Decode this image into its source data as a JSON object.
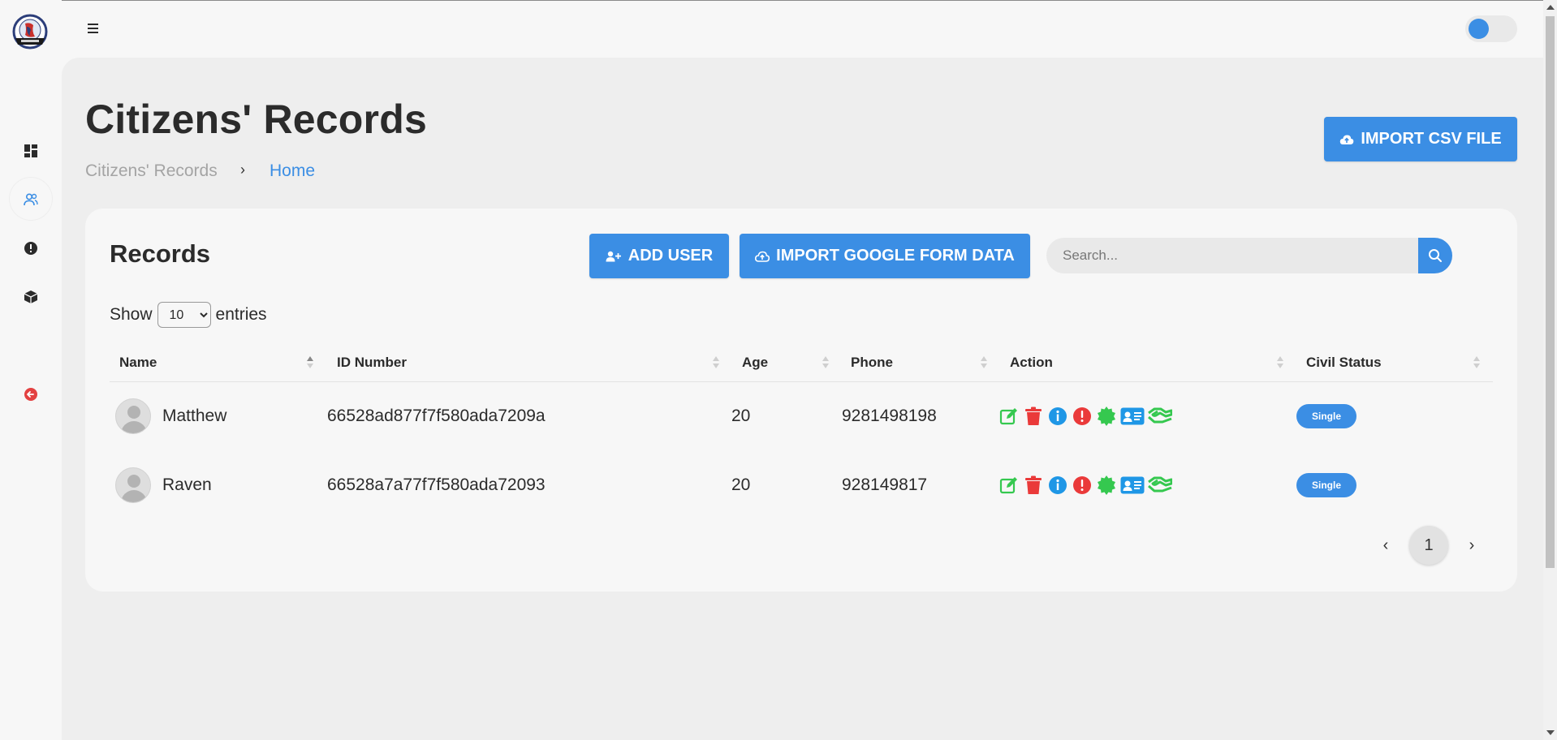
{
  "header": {
    "page_title": "Citizens' Records",
    "breadcrumb": [
      "Citizens' Records",
      "Home"
    ],
    "import_csv_label": "IMPORT CSV FILE",
    "theme_toggle_on": true
  },
  "sidebar": {
    "items": [
      {
        "name": "dashboard-icon"
      },
      {
        "name": "users-icon",
        "active": true
      },
      {
        "name": "alert-icon"
      },
      {
        "name": "box-icon"
      },
      {
        "name": "logout-icon"
      }
    ]
  },
  "card": {
    "title": "Records",
    "add_user_label": "ADD USER",
    "import_gform_label": "IMPORT GOOGLE FORM DATA",
    "search_placeholder": "Search...",
    "show_label": "Show",
    "entries_label": "entries",
    "entries_value": "10"
  },
  "table": {
    "columns": [
      "Name",
      "ID Number",
      "Age",
      "Phone",
      "Action",
      "Civil Status"
    ],
    "rows": [
      {
        "name": "Matthew",
        "id": "66528ad877f7f580ada7209a",
        "age": "20",
        "phone": "9281498198",
        "status": "Single"
      },
      {
        "name": "Raven",
        "id": "66528a7a77f7f580ada72093",
        "age": "20",
        "phone": "928149817",
        "status": "Single"
      }
    ]
  },
  "pagination": {
    "prev": "‹",
    "current": "1",
    "next": "›"
  },
  "colors": {
    "accent": "#3b8ee4",
    "edit": "#35c84f",
    "delete": "#ea3a3a",
    "info": "#1f97e6",
    "warning": "#ea3a3a",
    "badge": "#35c84f",
    "idcard": "#1f97e6",
    "handshake": "#35c84f"
  }
}
